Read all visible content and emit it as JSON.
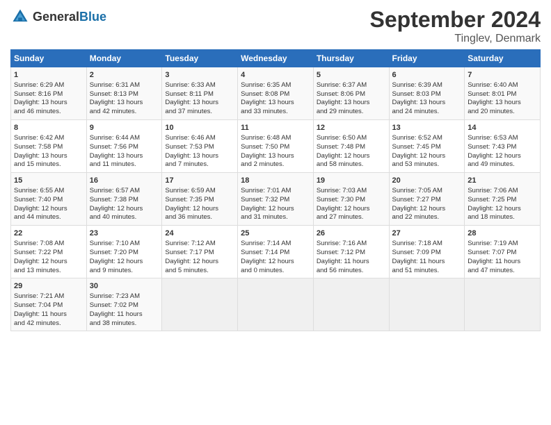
{
  "header": {
    "logo_general": "General",
    "logo_blue": "Blue",
    "month": "September 2024",
    "location": "Tinglev, Denmark"
  },
  "weekdays": [
    "Sunday",
    "Monday",
    "Tuesday",
    "Wednesday",
    "Thursday",
    "Friday",
    "Saturday"
  ],
  "weeks": [
    [
      {
        "day": "1",
        "info": "Sunrise: 6:29 AM\nSunset: 8:16 PM\nDaylight: 13 hours\nand 46 minutes."
      },
      {
        "day": "2",
        "info": "Sunrise: 6:31 AM\nSunset: 8:13 PM\nDaylight: 13 hours\nand 42 minutes."
      },
      {
        "day": "3",
        "info": "Sunrise: 6:33 AM\nSunset: 8:11 PM\nDaylight: 13 hours\nand 37 minutes."
      },
      {
        "day": "4",
        "info": "Sunrise: 6:35 AM\nSunset: 8:08 PM\nDaylight: 13 hours\nand 33 minutes."
      },
      {
        "day": "5",
        "info": "Sunrise: 6:37 AM\nSunset: 8:06 PM\nDaylight: 13 hours\nand 29 minutes."
      },
      {
        "day": "6",
        "info": "Sunrise: 6:39 AM\nSunset: 8:03 PM\nDaylight: 13 hours\nand 24 minutes."
      },
      {
        "day": "7",
        "info": "Sunrise: 6:40 AM\nSunset: 8:01 PM\nDaylight: 13 hours\nand 20 minutes."
      }
    ],
    [
      {
        "day": "8",
        "info": "Sunrise: 6:42 AM\nSunset: 7:58 PM\nDaylight: 13 hours\nand 15 minutes."
      },
      {
        "day": "9",
        "info": "Sunrise: 6:44 AM\nSunset: 7:56 PM\nDaylight: 13 hours\nand 11 minutes."
      },
      {
        "day": "10",
        "info": "Sunrise: 6:46 AM\nSunset: 7:53 PM\nDaylight: 13 hours\nand 7 minutes."
      },
      {
        "day": "11",
        "info": "Sunrise: 6:48 AM\nSunset: 7:50 PM\nDaylight: 13 hours\nand 2 minutes."
      },
      {
        "day": "12",
        "info": "Sunrise: 6:50 AM\nSunset: 7:48 PM\nDaylight: 12 hours\nand 58 minutes."
      },
      {
        "day": "13",
        "info": "Sunrise: 6:52 AM\nSunset: 7:45 PM\nDaylight: 12 hours\nand 53 minutes."
      },
      {
        "day": "14",
        "info": "Sunrise: 6:53 AM\nSunset: 7:43 PM\nDaylight: 12 hours\nand 49 minutes."
      }
    ],
    [
      {
        "day": "15",
        "info": "Sunrise: 6:55 AM\nSunset: 7:40 PM\nDaylight: 12 hours\nand 44 minutes."
      },
      {
        "day": "16",
        "info": "Sunrise: 6:57 AM\nSunset: 7:38 PM\nDaylight: 12 hours\nand 40 minutes."
      },
      {
        "day": "17",
        "info": "Sunrise: 6:59 AM\nSunset: 7:35 PM\nDaylight: 12 hours\nand 36 minutes."
      },
      {
        "day": "18",
        "info": "Sunrise: 7:01 AM\nSunset: 7:32 PM\nDaylight: 12 hours\nand 31 minutes."
      },
      {
        "day": "19",
        "info": "Sunrise: 7:03 AM\nSunset: 7:30 PM\nDaylight: 12 hours\nand 27 minutes."
      },
      {
        "day": "20",
        "info": "Sunrise: 7:05 AM\nSunset: 7:27 PM\nDaylight: 12 hours\nand 22 minutes."
      },
      {
        "day": "21",
        "info": "Sunrise: 7:06 AM\nSunset: 7:25 PM\nDaylight: 12 hours\nand 18 minutes."
      }
    ],
    [
      {
        "day": "22",
        "info": "Sunrise: 7:08 AM\nSunset: 7:22 PM\nDaylight: 12 hours\nand 13 minutes."
      },
      {
        "day": "23",
        "info": "Sunrise: 7:10 AM\nSunset: 7:20 PM\nDaylight: 12 hours\nand 9 minutes."
      },
      {
        "day": "24",
        "info": "Sunrise: 7:12 AM\nSunset: 7:17 PM\nDaylight: 12 hours\nand 5 minutes."
      },
      {
        "day": "25",
        "info": "Sunrise: 7:14 AM\nSunset: 7:14 PM\nDaylight: 12 hours\nand 0 minutes."
      },
      {
        "day": "26",
        "info": "Sunrise: 7:16 AM\nSunset: 7:12 PM\nDaylight: 11 hours\nand 56 minutes."
      },
      {
        "day": "27",
        "info": "Sunrise: 7:18 AM\nSunset: 7:09 PM\nDaylight: 11 hours\nand 51 minutes."
      },
      {
        "day": "28",
        "info": "Sunrise: 7:19 AM\nSunset: 7:07 PM\nDaylight: 11 hours\nand 47 minutes."
      }
    ],
    [
      {
        "day": "29",
        "info": "Sunrise: 7:21 AM\nSunset: 7:04 PM\nDaylight: 11 hours\nand 42 minutes."
      },
      {
        "day": "30",
        "info": "Sunrise: 7:23 AM\nSunset: 7:02 PM\nDaylight: 11 hours\nand 38 minutes."
      },
      {
        "day": "",
        "info": ""
      },
      {
        "day": "",
        "info": ""
      },
      {
        "day": "",
        "info": ""
      },
      {
        "day": "",
        "info": ""
      },
      {
        "day": "",
        "info": ""
      }
    ]
  ]
}
